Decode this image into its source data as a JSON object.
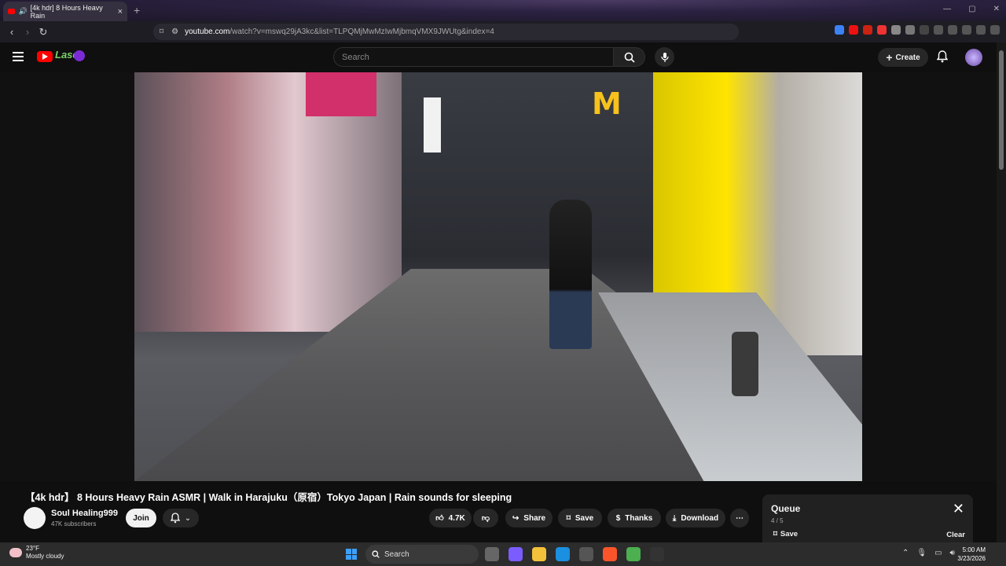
{
  "browser": {
    "tab_title": "[4k hdr] 8 Hours Heavy Rain",
    "tab_close": "×",
    "new_tab": "+",
    "url_host": "youtube.com",
    "url_path": "/watch?v=mswq29jA3kc&list=TLPQMjMwMzIwMjbmqVMX9JWUtg&index=4"
  },
  "youtube": {
    "search_placeholder": "Search",
    "create_label": "Create",
    "doodle_text": "Lasc"
  },
  "video": {
    "title": "【4k hdr】 8 Hours Heavy Rain ASMR | Walk in Harajuku（原宿）Tokyo Japan | Rain sounds for sleeping",
    "channel_name": "Soul Healing999",
    "subscribers": "47K subscribers",
    "join_label": "Join",
    "like_count": "4.7K",
    "share_label": "Share",
    "save_label": "Save",
    "thanks_label": "Thanks",
    "download_label": "Download",
    "more_label": "⋯"
  },
  "queue": {
    "title": "Queue",
    "position": "4 / 5",
    "save_label": "Save",
    "clear_label": "Clear"
  },
  "taskbar": {
    "temperature": "23°F",
    "weather_desc": "Mostly cloudy",
    "search_label": "Search",
    "time": "5:00 AM",
    "date": "3/23/2026"
  }
}
